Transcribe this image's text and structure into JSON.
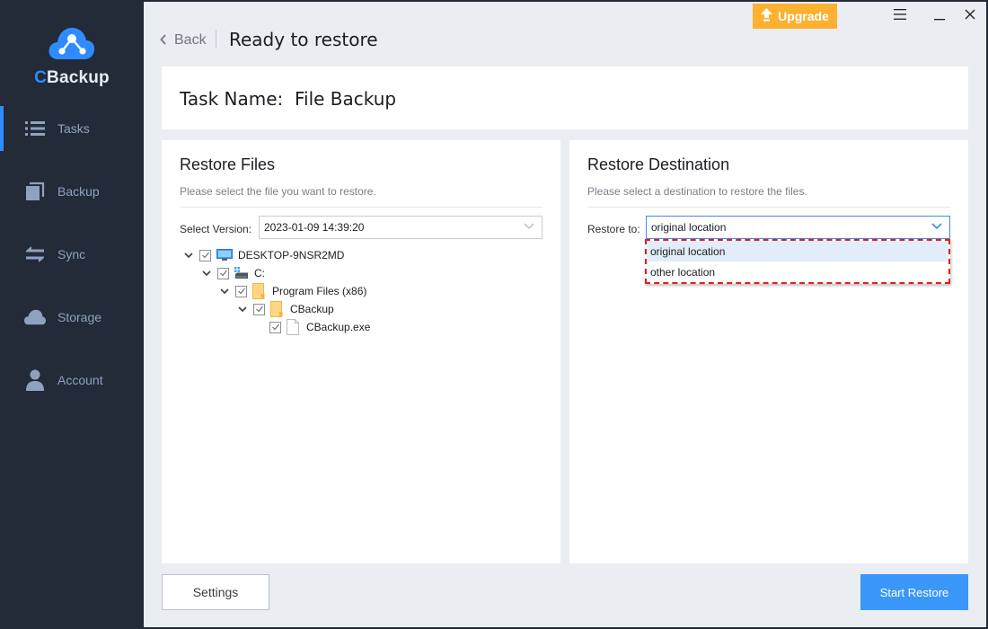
{
  "app": {
    "name_prefix": "C",
    "name_rest": "Backup",
    "accent_color": "#2f8cff"
  },
  "sidebar": {
    "items": [
      {
        "label": "Tasks",
        "icon": "list-icon",
        "active": true
      },
      {
        "label": "Backup",
        "icon": "copy-icon",
        "active": false
      },
      {
        "label": "Sync",
        "icon": "sync-arrows-icon",
        "active": false
      },
      {
        "label": "Storage",
        "icon": "cloud-icon",
        "active": false
      },
      {
        "label": "Account",
        "icon": "user-icon",
        "active": false
      }
    ]
  },
  "header": {
    "back_label": "Back",
    "title": "Ready to restore",
    "upgrade_label": "Upgrade",
    "upgrade_color": "#fdb130"
  },
  "task": {
    "label": "Task Name:",
    "name": "File Backup"
  },
  "restore_files": {
    "title": "Restore Files",
    "subtitle": "Please select the file you want to restore.",
    "version_label": "Select Version:",
    "version_value": "2023-01-09 14:39:20",
    "tree": [
      {
        "label": "DESKTOP-9NSR2MD",
        "icon": "computer-icon",
        "expanded": true,
        "checked": true,
        "depth": 0
      },
      {
        "label": "C:",
        "icon": "drive-icon",
        "expanded": true,
        "checked": true,
        "depth": 1
      },
      {
        "label": "Program Files (x86)",
        "icon": "folder-icon",
        "expanded": true,
        "checked": true,
        "depth": 2
      },
      {
        "label": "CBackup",
        "icon": "folder-icon",
        "expanded": true,
        "checked": true,
        "depth": 3
      },
      {
        "label": "CBackup.exe",
        "icon": "file-icon",
        "expanded": null,
        "checked": true,
        "depth": 4
      }
    ]
  },
  "restore_destination": {
    "title": "Restore Destination",
    "subtitle": "Please select a destination to restore the files.",
    "restore_to_label": "Restore to:",
    "restore_to_value": "original location",
    "options": [
      {
        "label": "original location",
        "selected": true
      },
      {
        "label": "other location",
        "selected": false
      }
    ],
    "highlight_color": "#e31c1c"
  },
  "footer": {
    "settings_label": "Settings",
    "start_label": "Start Restore",
    "start_color": "#3a97f9"
  }
}
